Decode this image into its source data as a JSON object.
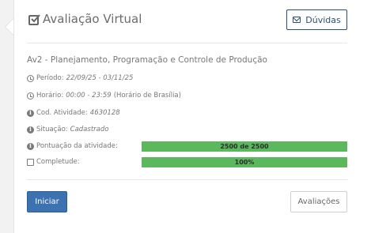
{
  "header": {
    "title": "Avaliação Virtual",
    "help_label": "Dúvidas"
  },
  "activity": {
    "name": "Av2 - Planejamento, Programação e Controle de Produção",
    "period_label": "Período:",
    "period_value": "22/09/25 - 03/11/25",
    "time_label": "Horário:",
    "time_value": "00:00 - 23:59",
    "time_zone": "(Horário de Brasília)",
    "code_label": "Cod. Atividade:",
    "code_value": "4630128",
    "status_label": "Situação:",
    "status_value": "Cadastrado",
    "score_label": "Pontuação da atividade:",
    "score_text": "2500 de 2500",
    "score_fraction": 1.0,
    "completion_label": "Completude:",
    "completion_text": "100%",
    "completion_fraction": 1.0
  },
  "footer": {
    "start_label": "Iniciar",
    "evaluations_label": "Avaliações"
  },
  "colors": {
    "accent": "#3d72b0",
    "progress": "#5cb85c",
    "help_border": "#2a4e7a"
  },
  "icons": {
    "title": "check-square-icon",
    "help": "envelope-icon",
    "period": "clock-icon",
    "time": "clock-icon",
    "code": "info-circle-icon",
    "status": "info-circle-icon",
    "score": "info-circle-icon",
    "completion": "external-link-icon"
  }
}
